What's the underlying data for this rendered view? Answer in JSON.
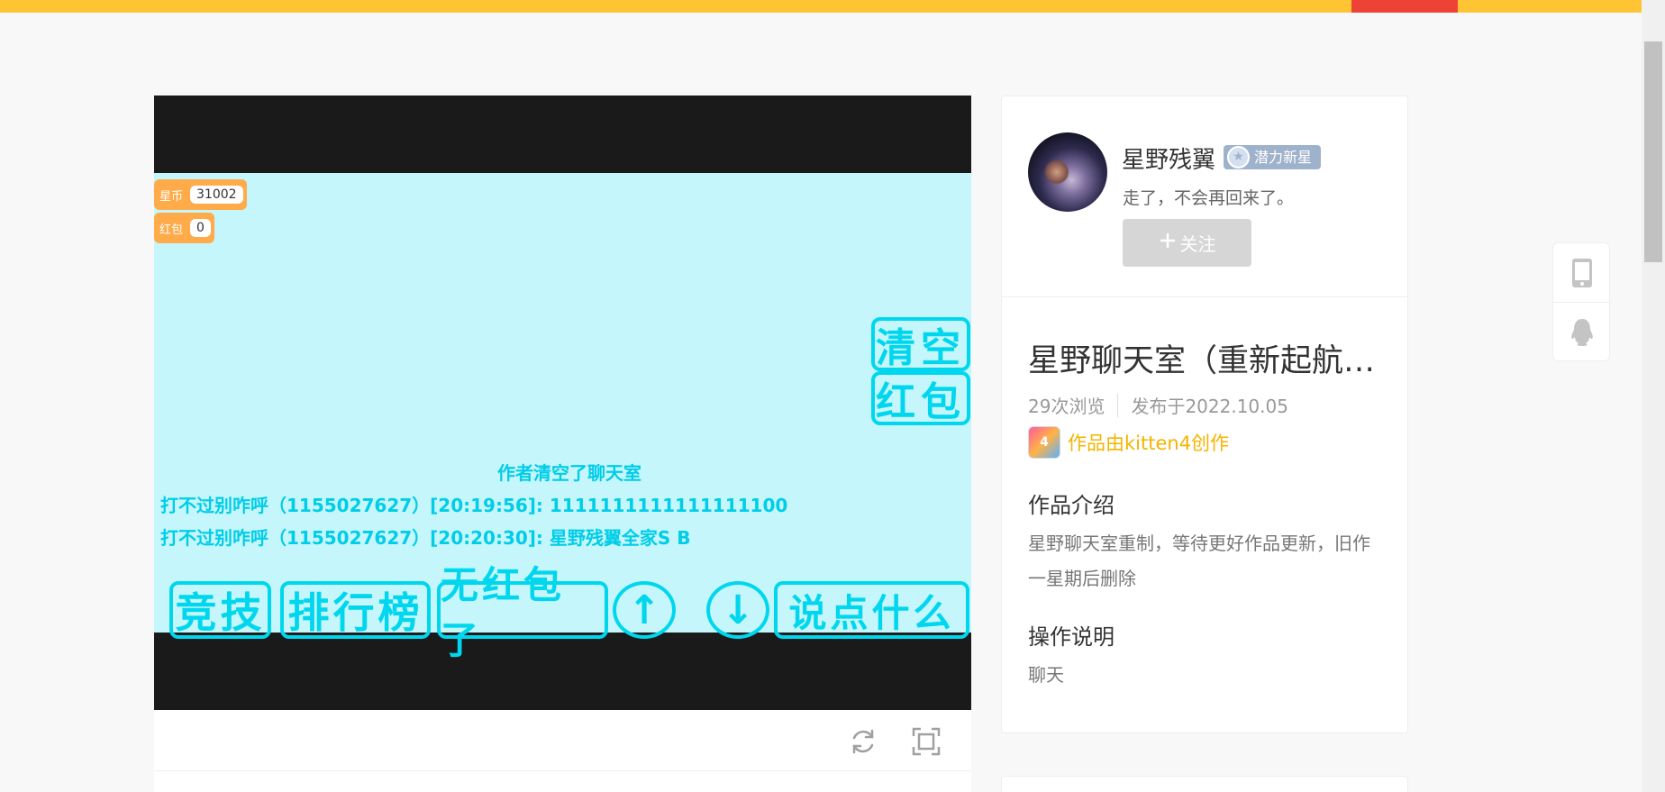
{
  "stage": {
    "vars": [
      {
        "label": "星币",
        "value": "31002"
      },
      {
        "label": "红包",
        "value": "0"
      }
    ],
    "right_buttons": [
      "清空",
      "红包"
    ],
    "messages": {
      "center": "作者清空了聊天室",
      "line1": "打不过别咋呼（1155027627）[20:19:56]: 1111111111111111100",
      "line2": "打不过别咋呼（1155027627）[20:20:30]: 星野残翼全家S B"
    },
    "bottom_buttons": [
      "竞技",
      "排行榜",
      "无红包了",
      "↑",
      "↓",
      "说点什么"
    ]
  },
  "author": {
    "name": "星野残翼",
    "badge": "潜力新星",
    "bio": "走了，不会再回来了。",
    "follow_label": "关注"
  },
  "work": {
    "title": "星野聊天室（重新起航…",
    "views": "29次浏览",
    "published": "发布于2022.10.05",
    "made_with": "作品由kitten4创作",
    "intro_heading": "作品介绍",
    "intro_text": "星野聊天室重制，等待更好作品更新，旧作一星期后删除",
    "ops_heading": "操作说明",
    "ops_text": "聊天"
  },
  "colors": {
    "topbar": "#fec433",
    "accent_red": "#ef4236",
    "stage_bg": "#c5f6fb",
    "stage_text": "#00d7ee",
    "var_chip": "#ffab4a",
    "badge": "#9fb2cc",
    "kitten_label": "#f5b400"
  },
  "icons": {
    "refresh": "refresh-icon",
    "fullscreen": "fullscreen-icon",
    "phone": "phone-icon",
    "qq": "qq-icon",
    "plus": "plus-icon",
    "star": "star-badge-icon"
  }
}
